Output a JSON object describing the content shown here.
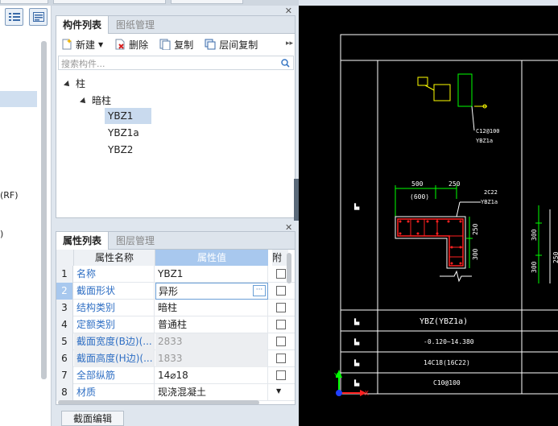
{
  "left_nav": {
    "items": [
      "(RF)",
      ")"
    ]
  },
  "component_panel": {
    "tabs": [
      "构件列表",
      "图纸管理"
    ],
    "toolbar": {
      "new": "新建",
      "delete": "删除",
      "copy": "复制",
      "floor_copy": "层间复制"
    },
    "search_placeholder": "搜索构件...",
    "tree": {
      "root": "柱",
      "child": "暗柱",
      "items": [
        "YBZ1",
        "YBZ1a",
        "YBZ2"
      ]
    }
  },
  "property_panel": {
    "tabs": [
      "属性列表",
      "图层管理"
    ],
    "columns": [
      "属性名称",
      "属性值",
      "附"
    ],
    "rows": [
      {
        "num": "1",
        "name": "名称",
        "value": "YBZ1"
      },
      {
        "num": "2",
        "name": "截面形状",
        "value": "异形"
      },
      {
        "num": "3",
        "name": "结构类别",
        "value": "暗柱"
      },
      {
        "num": "4",
        "name": "定额类别",
        "value": "普通柱"
      },
      {
        "num": "5",
        "name": "截面宽度(B边)(...",
        "value": "2833"
      },
      {
        "num": "6",
        "name": "截面高度(H边)(...",
        "value": "1833"
      },
      {
        "num": "7",
        "name": "全部纵筋",
        "value": "14⌀18"
      },
      {
        "num": "8",
        "name": "材质",
        "value": "现浇混凝土"
      }
    ],
    "ellipsis": "···"
  },
  "bottom_button": "截面编辑",
  "cad": {
    "label_c12": "C12@100",
    "label_ybz1a": "YBZ1a",
    "dim_500": "500",
    "dim_600": "(600)",
    "dim_250": "250",
    "label_2c22": "2C22",
    "label_ybz1a_2": "YBZ1a",
    "dim_250v": "250",
    "dim_300v": "300",
    "dim_300r": "300",
    "dim_250r": "250",
    "dim_300r2": "300",
    "title_name": "YBZ(YBZ1a)",
    "elevation": "-0.120~14.380",
    "bars": "14C18(16C22)",
    "stirrup": "C10@100",
    "axis_x": "X",
    "axis_y": "Y",
    "colors": {
      "bg": "#000000",
      "line": "#ffffff",
      "green": "#00ff00",
      "yellow": "#ffff00",
      "red": "#ff2020",
      "cyan": "#00ffff"
    }
  }
}
